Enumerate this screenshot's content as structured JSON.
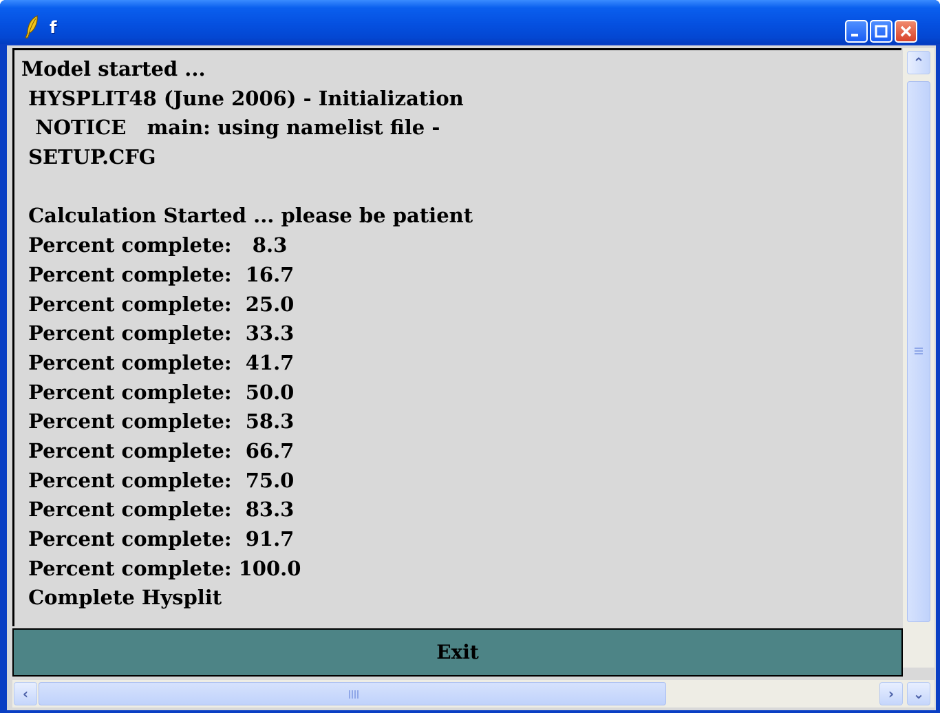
{
  "window": {
    "title": "f",
    "icon": "feather-icon",
    "controls": [
      "minimize-icon",
      "maximize-icon",
      "close-icon"
    ]
  },
  "log": {
    "lines": [
      "Model started ...",
      " HYSPLIT48 (June 2006) - Initialization",
      "  NOTICE   main: using namelist file -",
      " SETUP.CFG",
      "",
      " Calculation Started ... please be patient",
      " Percent complete:   8.3",
      " Percent complete:  16.7",
      " Percent complete:  25.0",
      " Percent complete:  33.3",
      " Percent complete:  41.7",
      " Percent complete:  50.0",
      " Percent complete:  58.3",
      " Percent complete:  66.7",
      " Percent complete:  75.0",
      " Percent complete:  83.3",
      " Percent complete:  91.7",
      " Percent complete: 100.0",
      " Complete Hysplit"
    ]
  },
  "exit_button": {
    "label": "Exit"
  },
  "colors": {
    "title_bar": "#0550e0",
    "client_bg": "#d9d9d9",
    "exit_button_bg": "#4d8486"
  }
}
